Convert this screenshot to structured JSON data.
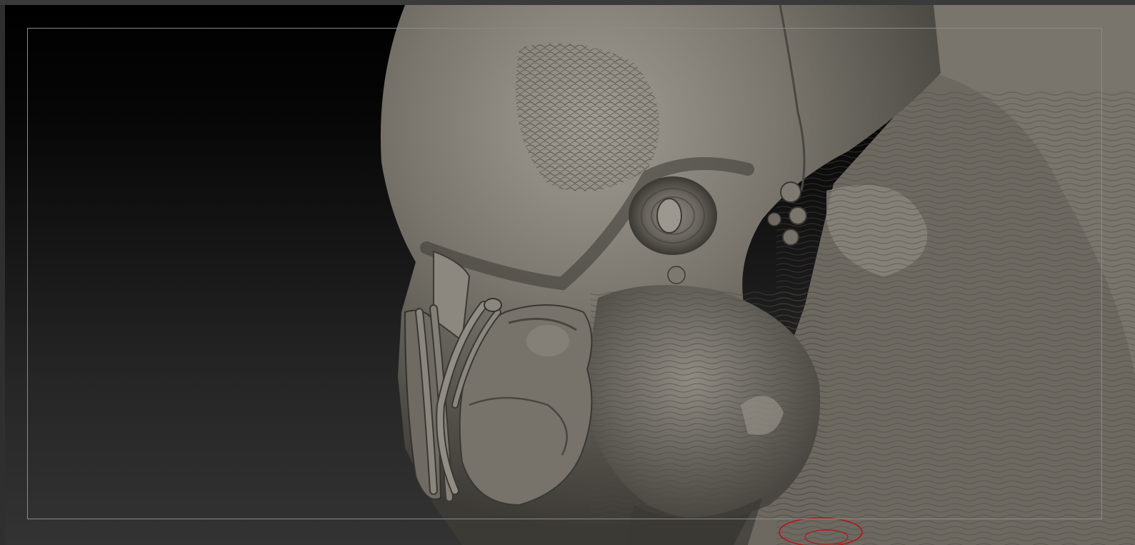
{
  "app": {
    "viewport": {
      "content": "sculpted-creature-head-model",
      "background_top_color": "#000000",
      "background_bottom_color": "#333333",
      "model_base_color": "#6b675f",
      "model_highlight_color": "#9a968d",
      "model_shadow_color": "#2a2824",
      "frame_color": "#8a8a8a",
      "brush_cursor_color": "#b01818"
    }
  }
}
